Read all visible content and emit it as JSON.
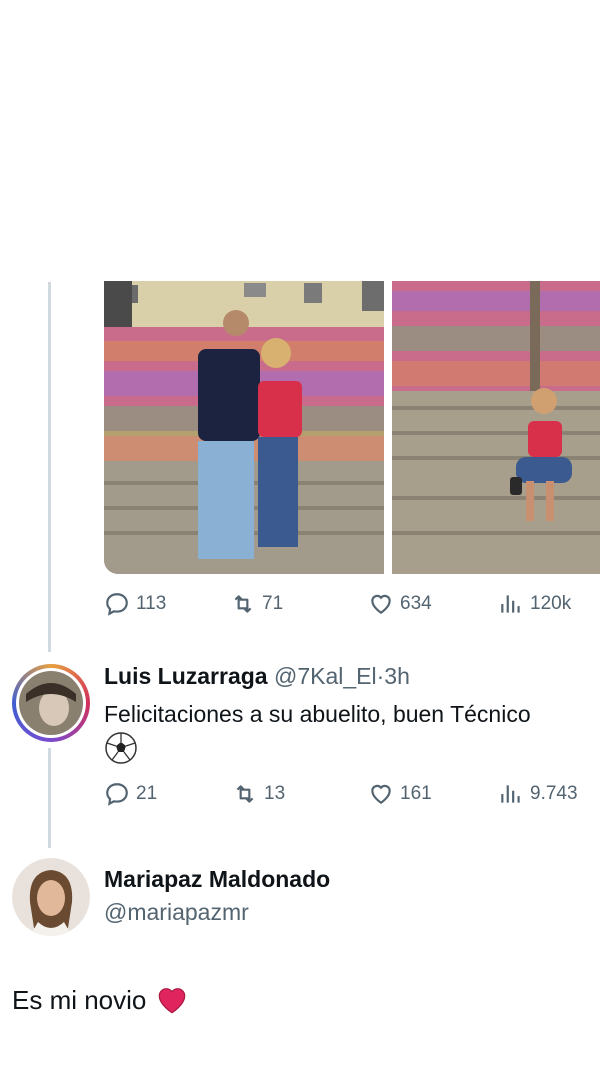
{
  "tweet": {
    "stats": {
      "replies": "113",
      "retweets": "71",
      "likes": "634",
      "views": "120k"
    }
  },
  "reply": {
    "name": "Luis Luzarraga",
    "handle": "@7Kal_El",
    "separator": "·",
    "time": "3h",
    "text": "Felicitaciones a su abuelito, buen Técnico",
    "emoji": "soccer-ball",
    "stats": {
      "replies": "21",
      "retweets": "13",
      "likes": "161",
      "views": "9.743"
    }
  },
  "post": {
    "name": "Mariapaz Maldonado",
    "handle": "@mariapazmr",
    "text": "Es mi novio",
    "emoji": "red-heart"
  },
  "colors": {
    "muted": "#536471",
    "thread_line": "#cfd9de",
    "heart": "#e0245e"
  }
}
